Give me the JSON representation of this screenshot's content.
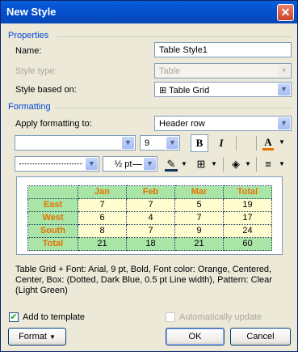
{
  "window": {
    "title": "New Style",
    "close_glyph": "✕"
  },
  "properties": {
    "heading": "Properties",
    "name_label": "Name:",
    "name_value": "Table Style1",
    "style_type_label": "Style type:",
    "style_type_value": "Table",
    "based_on_label": "Style based on:",
    "based_on_value": "Table Grid",
    "based_on_icon": "⊞"
  },
  "formatting": {
    "heading": "Formatting",
    "apply_label": "Apply formatting to:",
    "apply_value": "Header row",
    "font_value": "",
    "size_value": "9",
    "bold": "B",
    "italic": "I",
    "underline_color_letter": "A",
    "line_style_value": "",
    "line_weight_value": "½ pt",
    "font_color": "#e87400",
    "border_color": "#17365d"
  },
  "preview": {
    "headers": [
      "",
      "Jan",
      "Feb",
      "Mar",
      "Total"
    ],
    "rows": [
      [
        "East",
        "7",
        "7",
        "5",
        "19"
      ],
      [
        "West",
        "6",
        "4",
        "7",
        "17"
      ],
      [
        "South",
        "8",
        "7",
        "9",
        "24"
      ],
      [
        "Total",
        "21",
        "18",
        "21",
        "60"
      ]
    ]
  },
  "description": "Table Grid + Font: Arial, 9 pt, Bold, Font color: Orange, Centered, Center, Box: (Dotted, Dark Blue,  0.5 pt Line width), Pattern: Clear (Light Green)",
  "footer": {
    "add_to_template": "Add to template",
    "add_to_template_checked": true,
    "auto_update": "Automatically update",
    "auto_update_checked": false,
    "format_button": "Format",
    "ok_button": "OK",
    "cancel_button": "Cancel"
  }
}
